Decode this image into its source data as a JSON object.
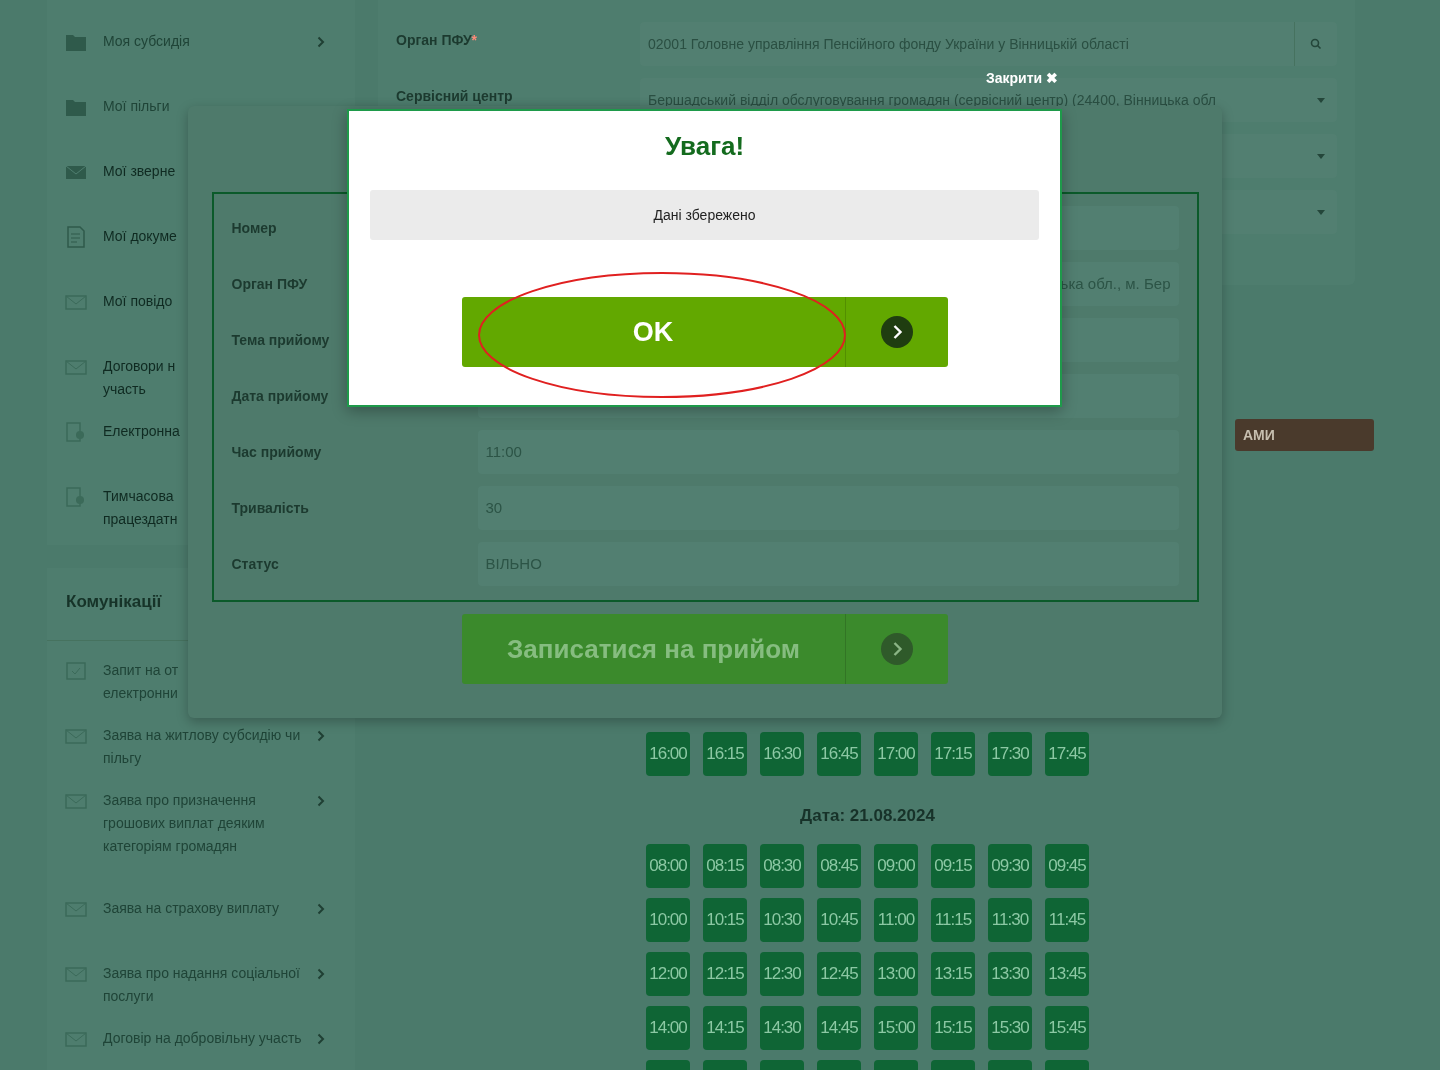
{
  "sidebar": {
    "items": [
      {
        "label": "Моя субсидія",
        "kind": "folder",
        "disabled": true,
        "chevron": true
      },
      {
        "label": "Мої пільги",
        "kind": "folder",
        "disabled": true
      },
      {
        "label": "Мої зверне",
        "kind": "envelope",
        "disabled": false
      },
      {
        "label": "Мої докуме",
        "kind": "document",
        "disabled": false
      },
      {
        "label": "Мої повідо",
        "kind": "message",
        "disabled": false
      },
      {
        "label": "Договори н\nучасть",
        "kind": "message",
        "disabled": false
      },
      {
        "label": "Електронна",
        "kind": "certificate",
        "disabled": false
      },
      {
        "label": "Тимчасова\nпрацездатн",
        "kind": "certificate",
        "disabled": false
      }
    ]
  },
  "communications": {
    "heading": "Комунікації",
    "items": [
      {
        "label": "Запит на от\nелектронни",
        "kind": "request"
      },
      {
        "label": "Заява на житлову субсидію чи пільгу",
        "kind": "message",
        "chevron": true
      },
      {
        "label": "Заява про призначення грошових виплат деяким категоріям громадян",
        "kind": "message",
        "chevron": true
      },
      {
        "label": "Заява на страхову виплату",
        "kind": "message",
        "chevron": true
      },
      {
        "label": "Заява про надання соціальної послуги",
        "kind": "message",
        "chevron": true
      },
      {
        "label": "Договір на добровільну участь",
        "kind": "message",
        "chevron": true
      }
    ]
  },
  "form": {
    "fields": [
      {
        "label": "Орган ПФУ",
        "required_mark": "*",
        "value": "02001 Головне управління Пенсійного фонду України у Вінницькій області",
        "kind": "search"
      },
      {
        "label": "Сервісний центр",
        "value": "Бершадський відділ обслуговування громадян (сервісний центр) (24400, Вінницька обл",
        "kind": "select"
      },
      {
        "kind": "select"
      },
      {
        "kind": "select"
      }
    ]
  },
  "side_button": {
    "label": "АМИ"
  },
  "schedule": {
    "first_row": [
      "16:00",
      "16:15",
      "16:30",
      "16:45",
      "17:00",
      "17:15",
      "17:30",
      "17:45"
    ],
    "date_label": "Дата: 21.08.2024",
    "slots": [
      "08:00",
      "08:15",
      "08:30",
      "08:45",
      "09:00",
      "09:15",
      "09:30",
      "09:45",
      "10:00",
      "10:15",
      "10:30",
      "10:45",
      "11:00",
      "11:15",
      "11:30",
      "11:45",
      "12:00",
      "12:15",
      "12:30",
      "12:45",
      "13:00",
      "13:15",
      "13:30",
      "13:45",
      "14:00",
      "14:15",
      "14:30",
      "14:45",
      "15:00",
      "15:15",
      "15:30",
      "15:45"
    ]
  },
  "details_modal": {
    "rows": [
      {
        "label": "Номер"
      },
      {
        "label": "Орган ПФУ",
        "value": "ька обл., м. Бер"
      },
      {
        "label": "Тема прийому"
      },
      {
        "label": "Дата прийому"
      },
      {
        "label": "Час прийому",
        "value": "11:00"
      },
      {
        "label": "Тривалість",
        "value": "30"
      },
      {
        "label": "Статус",
        "value": "ВІЛЬНО"
      }
    ],
    "submit_button": "Записатися на прийом"
  },
  "close_link": {
    "label": "Закрити",
    "icon": "✖"
  },
  "alert": {
    "title": "Увага!",
    "message": "Дані збережено",
    "ok_button": "OK"
  }
}
